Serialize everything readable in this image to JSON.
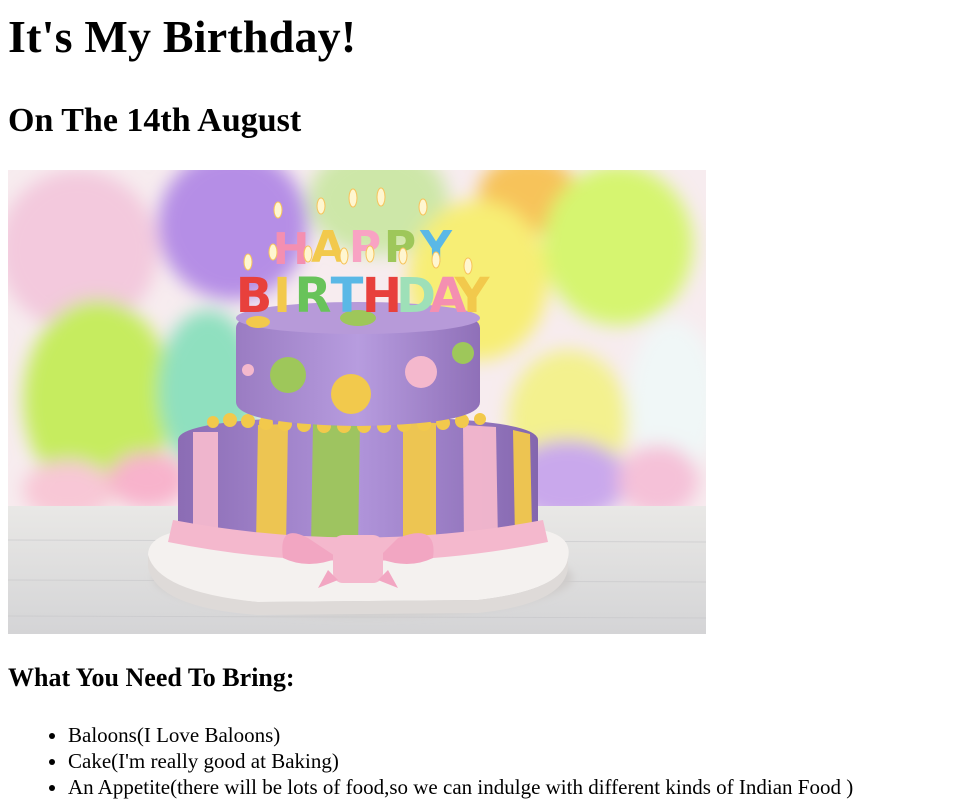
{
  "page": {
    "title": "It's My Birthday!",
    "subtitle": "On The 14th August",
    "bring_heading": "What You Need To Bring:",
    "bring_items": [
      "Baloons(I Love Baloons)",
      "Cake(I'm really good at Baking)",
      "An Appetite(there will be lots of food,so we can indulge with different kinds of Indian Food )"
    ]
  },
  "cake_image": {
    "letters_top": [
      "H",
      "A",
      "P",
      "P",
      "Y"
    ],
    "letters_bottom": [
      "B",
      "I",
      "R",
      "T",
      "H",
      "D",
      "A",
      "Y"
    ],
    "colors": {
      "purple": "#a98bd0",
      "pink": "#f4b8cd",
      "yellow": "#f2c94c",
      "green": "#9ec75a",
      "board": "#f4f1ef"
    }
  }
}
